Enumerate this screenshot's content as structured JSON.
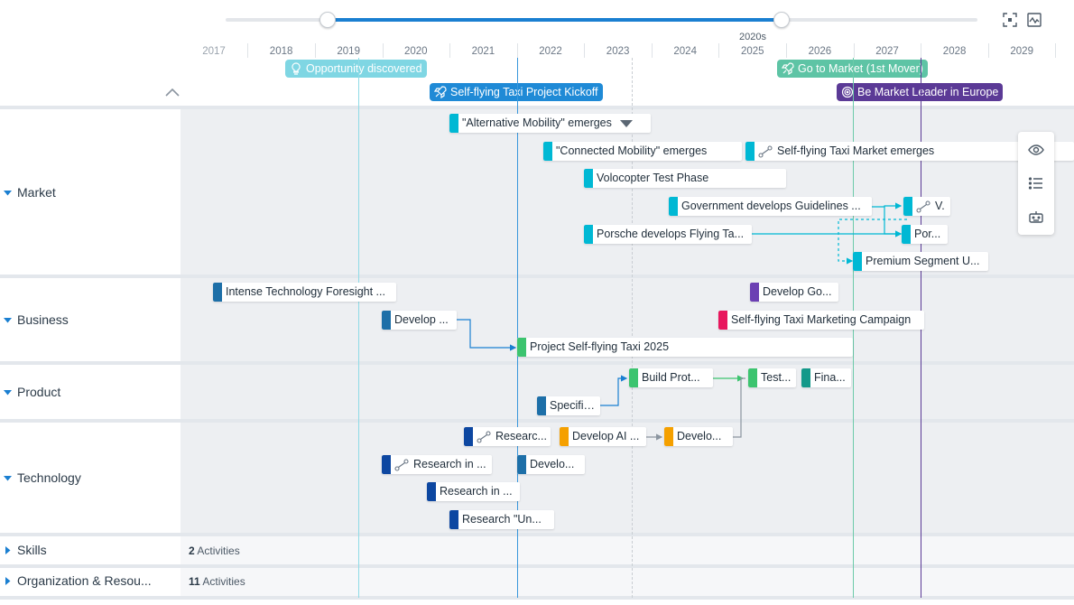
{
  "header": {
    "decade_label": "2020s",
    "years": [
      "2017",
      "2018",
      "2019",
      "2020",
      "2021",
      "2022",
      "2023",
      "2024",
      "2025",
      "2026",
      "2027",
      "2028",
      "2029"
    ],
    "icons": [
      "focus-icon",
      "chart-icon"
    ]
  },
  "milestones": [
    {
      "label": "Opportunity discovered",
      "color": "#7fd6e3",
      "icon": "bulb-icon"
    },
    {
      "label": "Self-flying Taxi Project Kickoff",
      "color": "#1f8ad6",
      "icon": "rocket-icon"
    },
    {
      "label": "Go to Market (1st Mover)",
      "color": "#5ec4a5",
      "icon": "rocket-icon"
    },
    {
      "label": "Be Market Leader in Europe",
      "color": "#5b3a96",
      "icon": "target-icon"
    }
  ],
  "lanes": [
    {
      "label": "Market",
      "expanded": true
    },
    {
      "label": "Business",
      "expanded": true
    },
    {
      "label": "Product",
      "expanded": true
    },
    {
      "label": "Technology",
      "expanded": true
    },
    {
      "label": "Skills",
      "expanded": false,
      "count": "2",
      "count_label": "Activities"
    },
    {
      "label": "Organization & Resou...",
      "expanded": false,
      "count": "11",
      "count_label": "Activities"
    }
  ],
  "tasks": {
    "market": [
      {
        "label": "\"Alternative Mobility\" emerges",
        "color": "#00b8d4"
      },
      {
        "label": "\"Connected Mobility\" emerges",
        "color": "#00b8d4"
      },
      {
        "label": "Self-flying Taxi Market emerges",
        "color": "#00b8d4"
      },
      {
        "label": "Volocopter Test Phase",
        "color": "#00b8d4"
      },
      {
        "label": "Government develops Guidelines ...",
        "color": "#00b8d4"
      },
      {
        "label": "V.",
        "color": "#00b8d4"
      },
      {
        "label": "Porsche develops Flying Ta...",
        "color": "#00b8d4"
      },
      {
        "label": "Por...",
        "color": "#00b8d4"
      },
      {
        "label": "Premium Segment U...",
        "color": "#00b8d4"
      }
    ],
    "business": [
      {
        "label": "Intense Technology Foresight ...",
        "color": "#1d6fa8"
      },
      {
        "label": "Develop Go...",
        "color": "#6b3fb3"
      },
      {
        "label": "Develop ...",
        "color": "#1d6fa8"
      },
      {
        "label": "Self-flying Taxi Marketing Campaign",
        "color": "#e8175d"
      },
      {
        "label": "Project Self-flying Taxi 2025",
        "color": "#3cc46f"
      }
    ],
    "product": [
      {
        "label": "Build Prot...",
        "color": "#3cc46f"
      },
      {
        "label": "Test...",
        "color": "#3cc46f"
      },
      {
        "label": "Fina...",
        "color": "#14998a"
      },
      {
        "label": "Specific...",
        "color": "#1d6fa8"
      }
    ],
    "technology": [
      {
        "label": "Researc...",
        "color": "#0d47a1"
      },
      {
        "label": "Develop AI ...",
        "color": "#f5a000"
      },
      {
        "label": "Develo...",
        "color": "#f5a000"
      },
      {
        "label": "Research in ...",
        "color": "#0d47a1"
      },
      {
        "label": "Develo...",
        "color": "#1d6fa8"
      },
      {
        "label": "Research in ...",
        "color": "#0d47a1"
      },
      {
        "label": "Research \"Un...",
        "color": "#0d47a1"
      }
    ]
  },
  "side_panel": [
    "eye-icon",
    "list-icon",
    "robot-icon"
  ]
}
